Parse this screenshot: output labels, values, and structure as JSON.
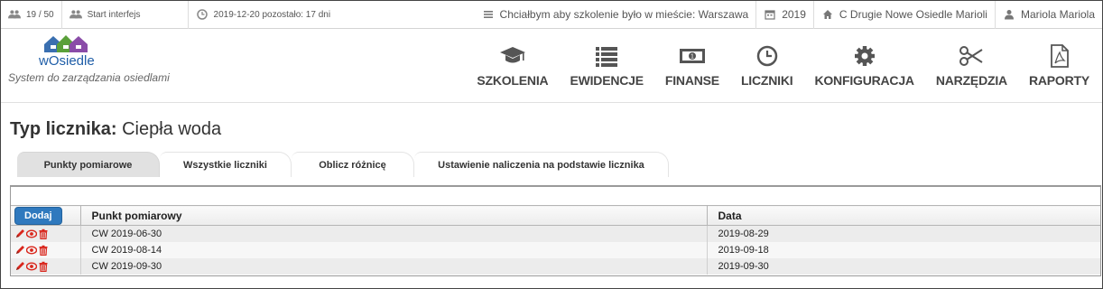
{
  "topbar": {
    "users_count": "19 / 50",
    "start_interface": "Start interfejs",
    "license": "2019-12-20 pozostało: 17 dni",
    "training_city": "Chciałbym aby szkolenie było w mieście: Warszawa",
    "year": "2019",
    "estate": "C Drugie Nowe Osiedle Marioli",
    "user": "Mariola Mariola"
  },
  "logo": {
    "text": "wOsiedle",
    "subtitle": "System do zarządzania osiedlami"
  },
  "nav": [
    {
      "label": "SZKOLENIA",
      "icon": "graduation-cap-icon"
    },
    {
      "label": "EWIDENCJE",
      "icon": "list-icon"
    },
    {
      "label": "FINANSE",
      "icon": "money-icon"
    },
    {
      "label": "LICZNIKI",
      "icon": "clock-icon"
    },
    {
      "label": "KONFIGURACJA",
      "icon": "gear-icon"
    },
    {
      "label": "NARZĘDZIA",
      "icon": "scissors-icon"
    },
    {
      "label": "RAPORTY",
      "icon": "pdf-file-icon"
    }
  ],
  "page": {
    "title_label": "Typ licznika:",
    "title_value": "Ciepła woda"
  },
  "tabs": [
    {
      "label": "Punkty pomiarowe",
      "active": true
    },
    {
      "label": "Wszystkie liczniki",
      "active": false
    },
    {
      "label": "Oblicz różnicę",
      "active": false
    },
    {
      "label": "Ustawienie naliczenia na podstawie licznika",
      "active": false
    }
  ],
  "table": {
    "add_label": "Dodaj",
    "columns": [
      "Punkt pomiarowy",
      "Data"
    ],
    "rows": [
      {
        "point": "CW 2019-06-30",
        "date": "2019-08-29"
      },
      {
        "point": "CW 2019-08-14",
        "date": "2019-09-18"
      },
      {
        "point": "CW 2019-09-30",
        "date": "2019-09-30"
      }
    ]
  },
  "colors": {
    "accent": "#2f79be",
    "action_red": "#d9261c"
  }
}
